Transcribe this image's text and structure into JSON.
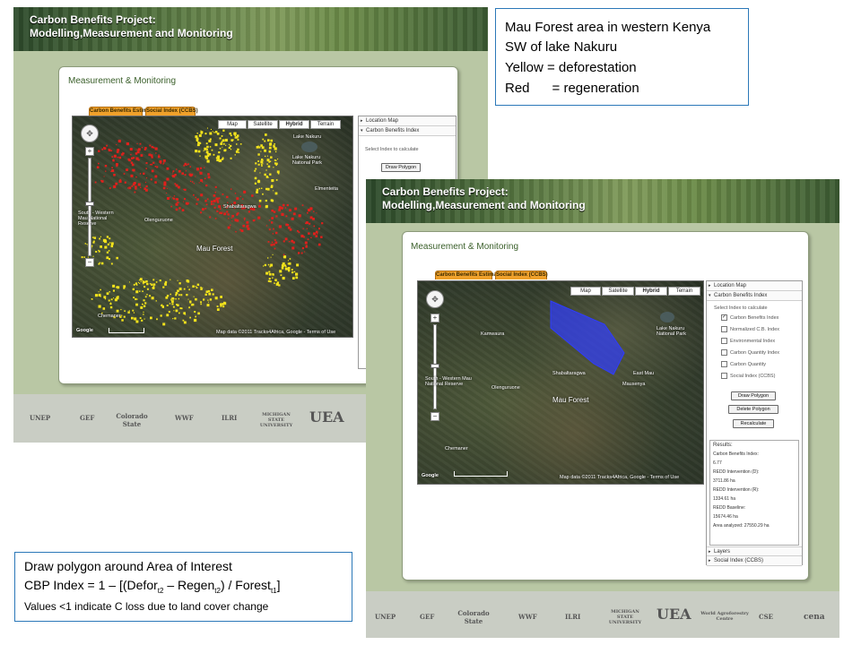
{
  "callout_top": {
    "lines": [
      "Mau Forest area in western Kenya",
      "SW of lake Nakuru",
      "Yellow = deforestation",
      "Red      = regeneration"
    ]
  },
  "callout_bottom": {
    "line1": "Draw polygon around Area of Interest",
    "formula_prefix": "CBP Index = 1 – [(Defor",
    "sub_t2a": "t2",
    "formula_mid": " – Regen",
    "sub_t2b": "t2",
    "formula_mid2": ") / Forest",
    "sub_t1": "t1",
    "formula_end": "]",
    "line3": "Values <1 indicate C loss due to land cover change"
  },
  "app": {
    "banner_line1": "Carbon Benefits Project:",
    "banner_line2": "Modelling,Measurement and Monitoring",
    "page_title": "Measurement & Monitoring",
    "tabs": [
      "Carbon Benefits Estimator",
      "Social Index (CCBS)"
    ],
    "map_types": [
      "Map",
      "Satellite",
      "Hybrid",
      "Terrain"
    ],
    "map_labels": {
      "lake_nakuru": "Lake Nakuru",
      "lake_nakuru_park": "Lake Nakuru National Park",
      "sw_mau": "South - Western Mau National Reserve",
      "olenguruone": "Olenguruone",
      "mau_forest": "Mau Forest",
      "shabaltaragwa": "Shabaltaragwa",
      "elementaita": "Elmenteita",
      "kamwaura": "Kamwaura",
      "chemaner": "Chemaner",
      "elburgon": "Elburgon",
      "mauseyan": "Mausenya",
      "east_mau": "East Mau"
    },
    "map_footer": "Map data ©2011 Tracks4Africa, Google - Terms of Use",
    "google_logo": "Google",
    "side": {
      "location_map": "Location Map",
      "cbi_header": "Carbon Benefits Index",
      "select_index": "Select Index to calculate",
      "indices": [
        "Carbon Benefits Index",
        "Normalized C.B. Index",
        "Environmental Index",
        "Carbon Quantity Index",
        "Carbon Quantity",
        "Social Index (CCBS)"
      ],
      "draw_polygon": "Draw Polygon",
      "delete_polygon": "Delete Polygon",
      "recalculate": "Recalculate",
      "results": [
        "Results:",
        "Carbon Benefits Index:",
        "6.77",
        "REDD Intervention (D):",
        "3711.86 ha",
        "REDD Intervention (R):",
        "1334.61 ha",
        "REDD Baseline:",
        "15674.46 ha",
        "Area analyzed: 27550.29 ha"
      ],
      "layers": "Layers",
      "social": "Social Index (CCBS)"
    },
    "logos": [
      "UNEP",
      "GEF",
      "Colorado State",
      "WWF",
      "ILRI",
      "MICHIGAN STATE UNIVERSITY",
      "UEA",
      "World Agroforestry Centre",
      "CSE",
      "cena"
    ]
  },
  "colors": {
    "deforestation": "#f2e21c",
    "regeneration": "#e0201c",
    "polygon": "#2f3cff",
    "callout_border": "#2b78b8",
    "tab_orange": "#f0a12b"
  }
}
